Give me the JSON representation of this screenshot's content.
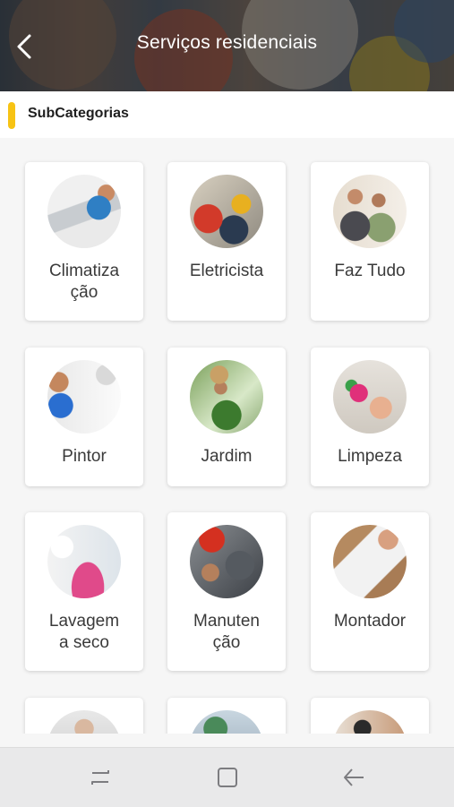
{
  "header": {
    "title": "Serviços residenciais",
    "back_icon": "arrow-left-icon"
  },
  "section": {
    "title": "SubCategorias",
    "accent_color": "#f7c314"
  },
  "subcategories": [
    {
      "label": "Climatiza\nção",
      "icon": "air-conditioning-technician-photo"
    },
    {
      "label": "Eletricista",
      "icon": "electrician-photo"
    },
    {
      "label": "Faz Tudo",
      "icon": "handyman-family-photo"
    },
    {
      "label": "Pintor",
      "icon": "painter-photo"
    },
    {
      "label": "Jardim",
      "icon": "gardener-photo"
    },
    {
      "label": "Limpeza",
      "icon": "cleaning-photo"
    },
    {
      "label": "Lavagem\na seco",
      "icon": "dry-cleaning-photo"
    },
    {
      "label": "Manuten\nção",
      "icon": "maintenance-photo"
    },
    {
      "label": "Montador",
      "icon": "furniture-assembler-photo"
    },
    {
      "label": "",
      "icon": "service-photo"
    },
    {
      "label": "",
      "icon": "service-photo"
    },
    {
      "label": "",
      "icon": "service-photo"
    }
  ],
  "navbar": {
    "recent_icon": "recent-apps-icon",
    "home_icon": "home-square-icon",
    "back_icon": "back-arrow-icon"
  }
}
